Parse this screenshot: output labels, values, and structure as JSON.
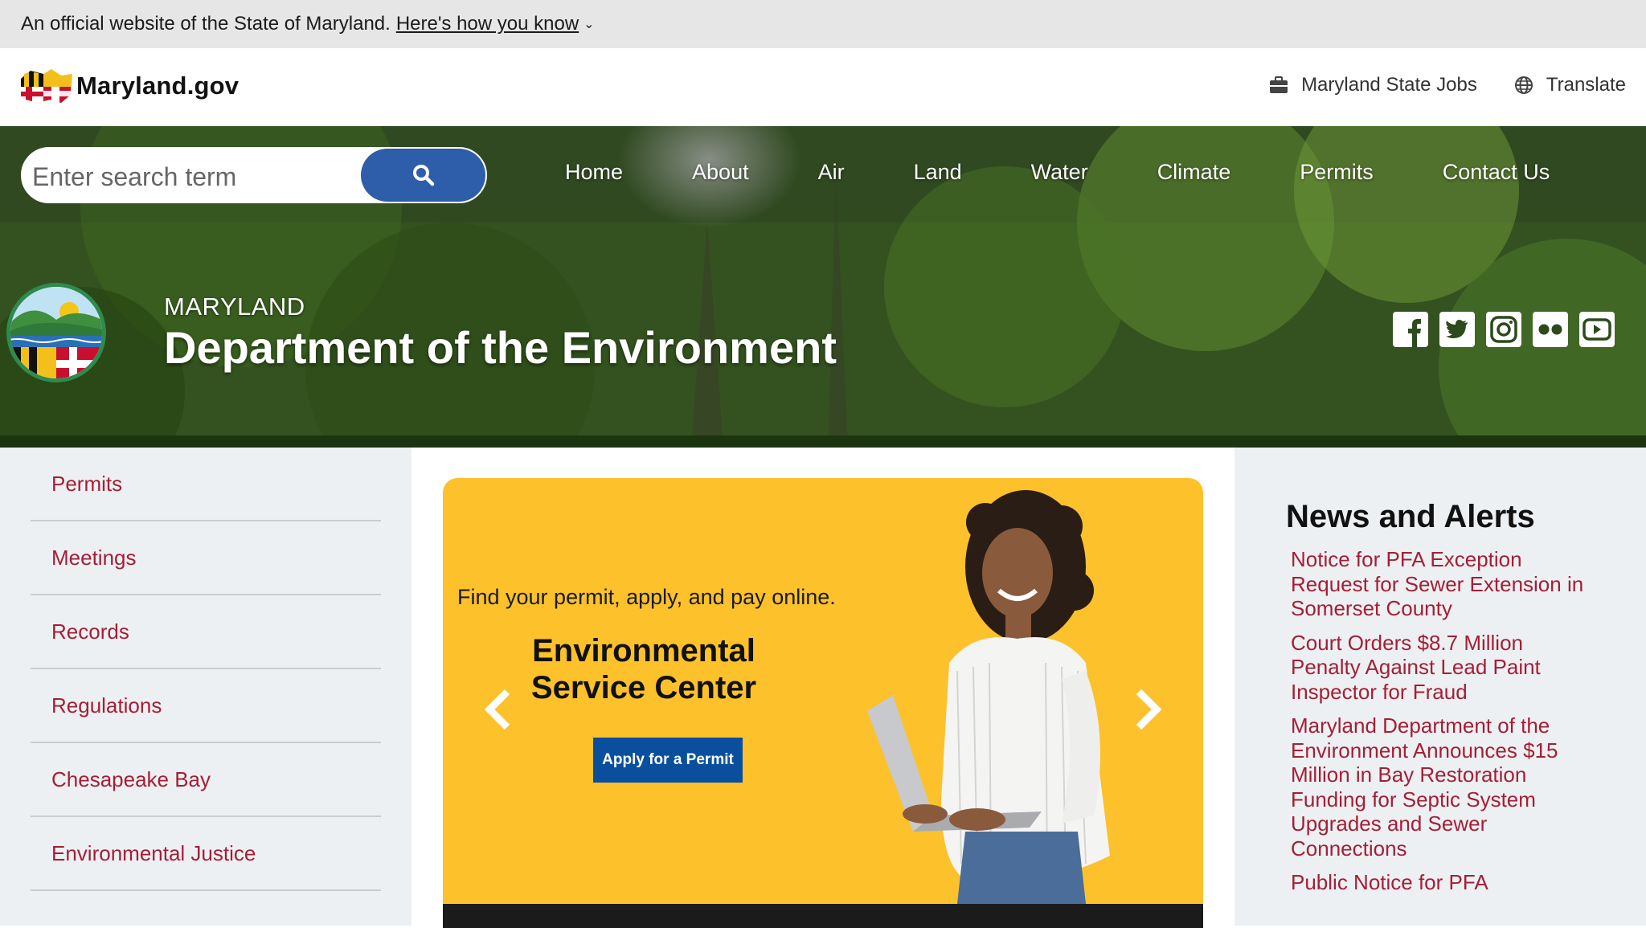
{
  "official_banner": {
    "text": "An official website of the State of Maryland.",
    "link": "Here's how you know",
    "chevron_icon": "chevron-down-icon"
  },
  "header": {
    "logo_text": "Maryland.gov",
    "utility": [
      {
        "label": "Maryland State Jobs",
        "icon": "briefcase-icon"
      },
      {
        "label": "Translate",
        "icon": "globe-icon"
      }
    ]
  },
  "search": {
    "placeholder": "Enter search term",
    "button_icon": "search-icon"
  },
  "nav": {
    "items": [
      "Home",
      "About",
      "Air",
      "Land",
      "Water",
      "Climate",
      "Permits",
      "Contact Us"
    ]
  },
  "agency": {
    "state": "MARYLAND",
    "title": "Department of the Environment"
  },
  "social": [
    "facebook-icon",
    "twitter-icon",
    "instagram-icon",
    "flickr-icon",
    "youtube-icon"
  ],
  "sidebar": {
    "items": [
      "Permits",
      "Meetings",
      "Records",
      "Regulations",
      "Chesapeake Bay",
      "Environmental Justice"
    ]
  },
  "carousel": {
    "caption": "Find your permit, apply, and pay online.",
    "title_line1": "Environmental",
    "title_line2": "Service Center",
    "cta": "Apply for a Permit"
  },
  "news": {
    "heading": "News and Alerts",
    "items": [
      "Notice for PFA Exception Request for Sewer Extension in Somerset County",
      "Court Orders $8.7 Million Penalty Against Lead Paint Inspector for Fraud",
      "Maryland Department of the Environment Announces $15 Million in Bay Restoration Funding for Septic System Upgrades and Sewer Connections",
      "Public Notice for PFA"
    ]
  },
  "colors": {
    "link": "#a51e36",
    "search_button": "#2e5eaa",
    "carousel_bg": "#fcc12b",
    "cta_bg": "#0a4f9e"
  }
}
